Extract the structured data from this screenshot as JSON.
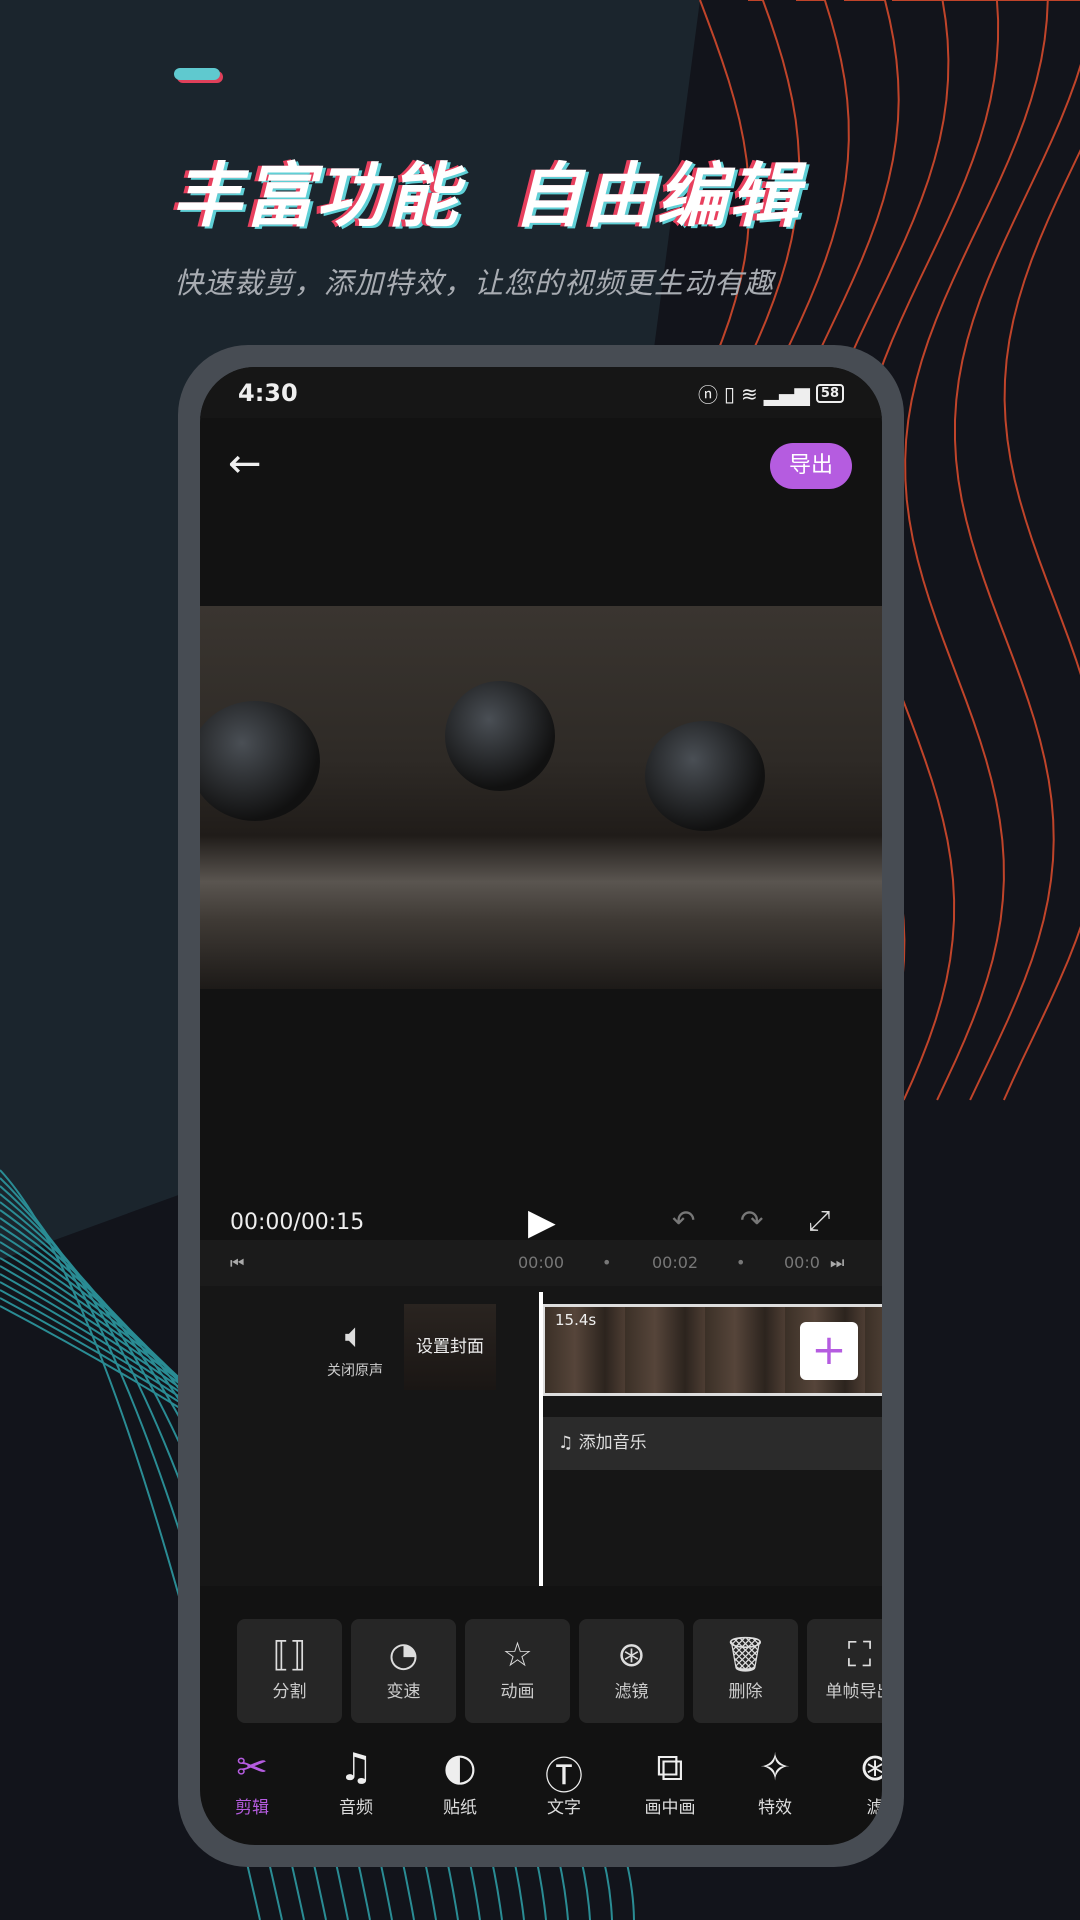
{
  "promo": {
    "title": "丰富功能  自由编辑",
    "subtitle": "快速裁剪，添加特效，让您的视频更生动有趣"
  },
  "colors": {
    "accent": "#b55ce0",
    "teal": "#5fc9cf",
    "red": "#e8405e",
    "wave": "#c0442a"
  },
  "status_bar": {
    "time": "4:30",
    "battery": "58",
    "icons": [
      "nfc-icon",
      "vibrate-icon",
      "wifi-icon",
      "signal-5g-icon",
      "battery-icon"
    ]
  },
  "header": {
    "back_icon": "arrow-left-icon",
    "export_label": "导出"
  },
  "player": {
    "timecode": "00:00/00:15",
    "play_icon": "play-icon",
    "undo_icon": "undo-icon",
    "redo_icon": "redo-icon",
    "fullscreen_icon": "expand-icon"
  },
  "ruler": {
    "ticks": [
      "00:00",
      "•",
      "00:02",
      "•",
      "00:0"
    ]
  },
  "tracks": {
    "mute_label": "关闭原声",
    "cover_label": "设置封面",
    "clip_duration": "15.4s",
    "add_music_label": "添加音乐"
  },
  "tools": [
    {
      "icon": "split-icon",
      "label": "分割"
    },
    {
      "icon": "speed-icon",
      "label": "变速"
    },
    {
      "icon": "animation-star-icon",
      "label": "动画"
    },
    {
      "icon": "filter-icon",
      "label": "滤镜"
    },
    {
      "icon": "trash-icon",
      "label": "删除"
    },
    {
      "icon": "frame-export-icon",
      "label": "单帧导出"
    }
  ],
  "nav": [
    {
      "icon": "scissors-icon",
      "label": "剪辑",
      "active": true
    },
    {
      "icon": "music-note-icon",
      "label": "音频"
    },
    {
      "icon": "sticker-icon",
      "label": "贴纸"
    },
    {
      "icon": "text-icon",
      "label": "文字"
    },
    {
      "icon": "picture-in-picture-icon",
      "label": "画中画"
    },
    {
      "icon": "magic-wand-icon",
      "label": "特效"
    },
    {
      "icon": "filter-icon",
      "label": "滤"
    }
  ]
}
